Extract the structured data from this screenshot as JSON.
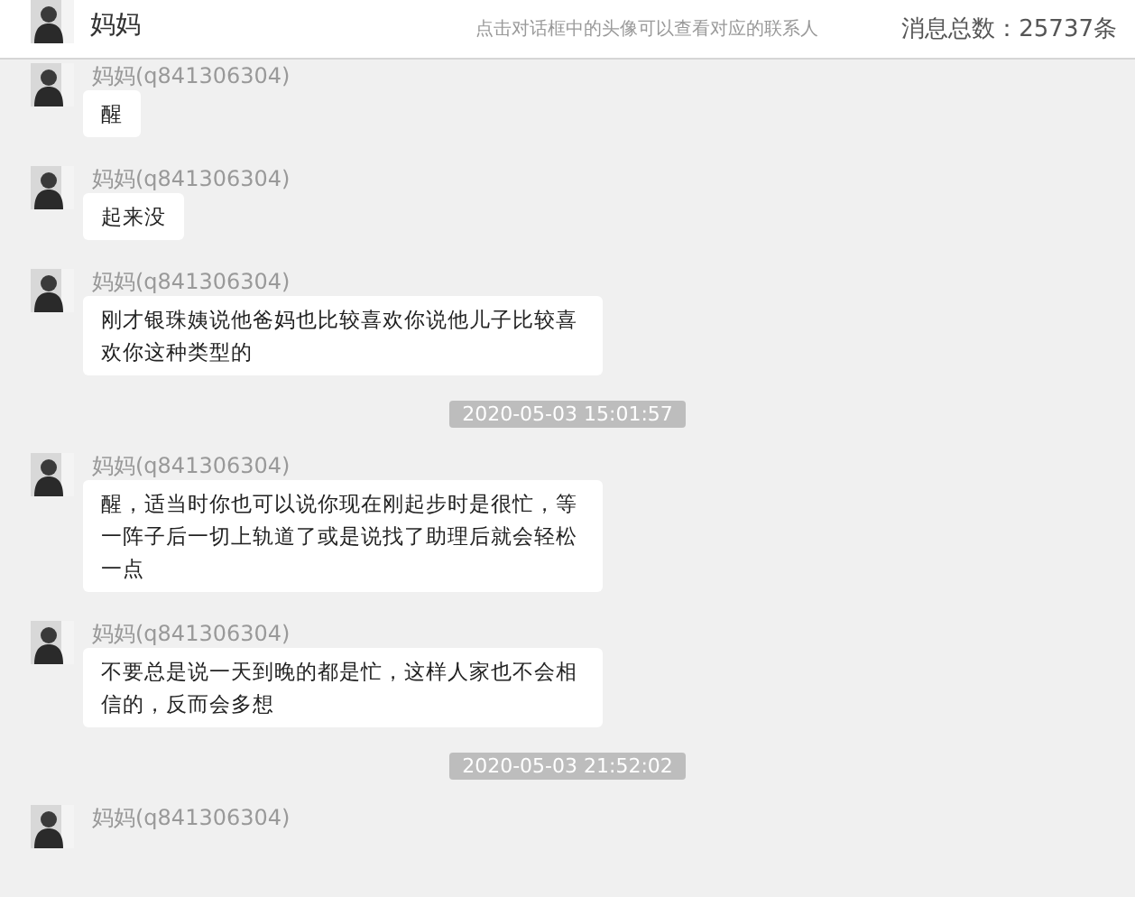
{
  "header": {
    "title": "妈妈",
    "hint": "点击对话框中的头像可以查看对应的联系人",
    "count": "消息总数：25737条"
  },
  "items": [
    {
      "kind": "message",
      "name": "妈妈(q841306304)",
      "text": "醒"
    },
    {
      "kind": "message",
      "name": "妈妈(q841306304)",
      "text": "起来没"
    },
    {
      "kind": "message",
      "name": "妈妈(q841306304)",
      "text": "刚才银珠姨说他爸妈也比较喜欢你说他儿子比较喜欢你这种类型的"
    },
    {
      "kind": "time",
      "text": "2020-05-03 15:01:57"
    },
    {
      "kind": "message",
      "name": "妈妈(q841306304)",
      "text": "醒，适当时你也可以说你现在刚起步时是很忙，等一阵子后一切上轨道了或是说找了助理后就会轻松一点"
    },
    {
      "kind": "message",
      "name": "妈妈(q841306304)",
      "text": "不要总是说一天到晚的都是忙，这样人家也不会相信的，反而会多想"
    },
    {
      "kind": "time",
      "text": "2020-05-03 21:52:02"
    },
    {
      "kind": "message",
      "name": "妈妈(q841306304)"
    }
  ]
}
